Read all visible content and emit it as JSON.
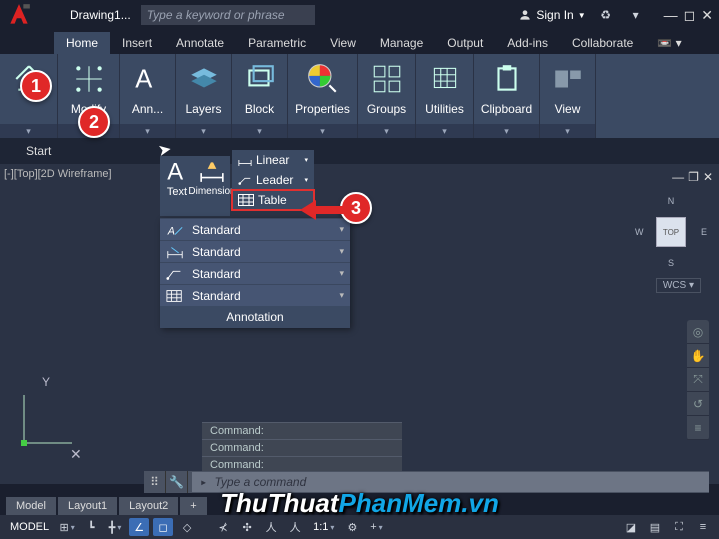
{
  "title": "Drawing1...",
  "search_placeholder": "Type a keyword or phrase",
  "signin": "Sign In",
  "menu": [
    "Home",
    "Insert",
    "Annotate",
    "Parametric",
    "View",
    "Manage",
    "Output",
    "Add-ins",
    "Collaborate"
  ],
  "ribbon": {
    "p0_label": "",
    "p1_label": "Modify",
    "p2_label": "Ann...",
    "p3_label": "Layers",
    "p4_label": "Block",
    "p5_label": "Properties",
    "p6_label": "Groups",
    "p7_label": "Utilities",
    "p8_label": "Clipboard",
    "p9_label": "View"
  },
  "start": "Start",
  "vp_label": "[-][Top][2D Wireframe]",
  "flyout": {
    "text_label": "Text",
    "dim_label": "Dimension",
    "linear": "Linear",
    "leader": "Leader",
    "table": "Table",
    "rows": [
      "Standard",
      "Standard",
      "Standard",
      "Standard"
    ],
    "panel_title": "Annotation"
  },
  "cmd_history": [
    "Command:",
    "Command:",
    "Command:"
  ],
  "cmd_placeholder": "Type a command",
  "layout_tabs": [
    "Model",
    "Layout1",
    "Layout2"
  ],
  "layout_status_tabs": [
    "MODEL",
    "Layout1",
    "Layout2"
  ],
  "compass": {
    "n": "N",
    "s": "S",
    "e": "E",
    "w": "W"
  },
  "cube_face": "TOP",
  "wcs": "WCS",
  "status": {
    "model": "MODEL",
    "scale": "1:1"
  },
  "markers": {
    "m1": "1",
    "m2": "2",
    "m3": "3"
  },
  "ucs_y": "Y",
  "watermark_a": "ThuThuat",
  "watermark_b": "PhanMem.vn"
}
